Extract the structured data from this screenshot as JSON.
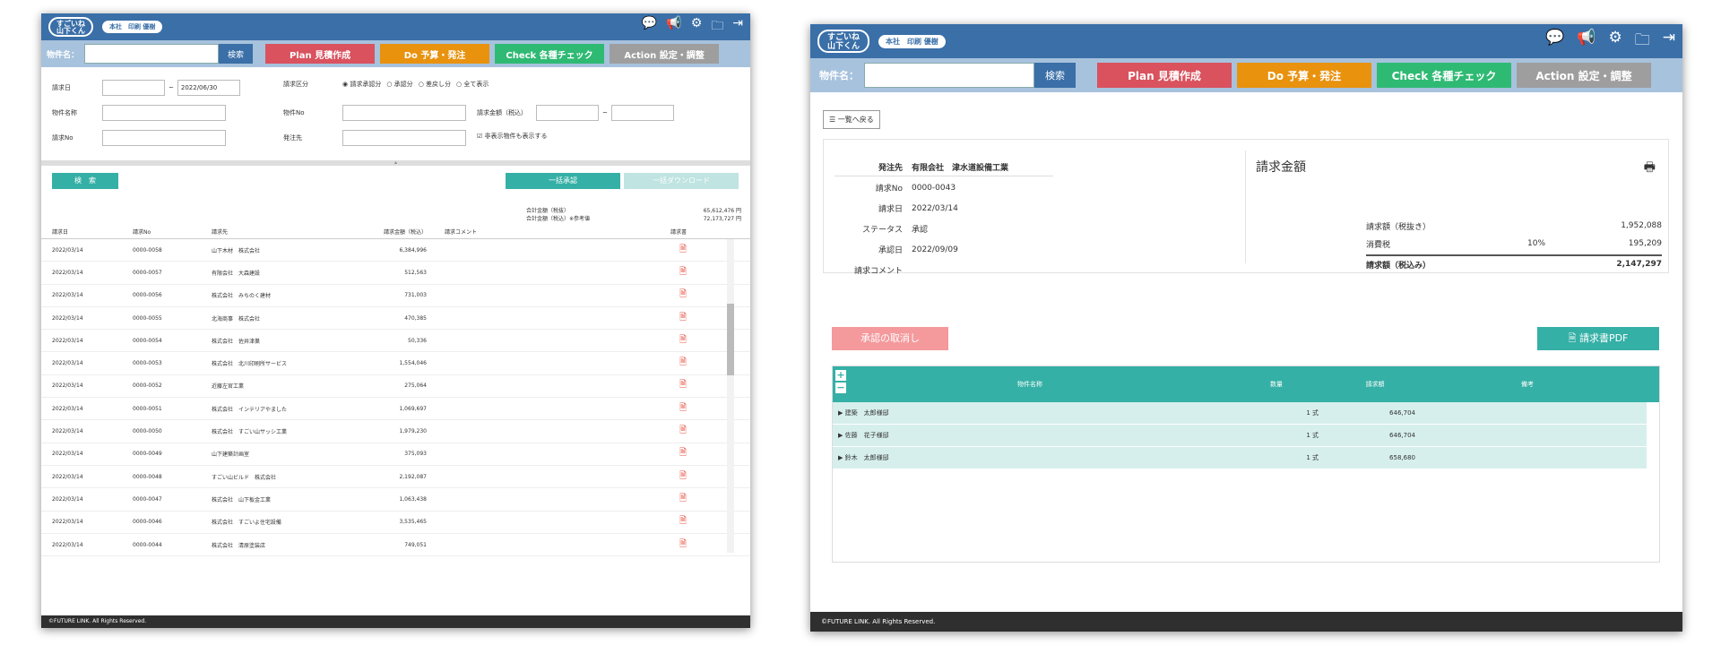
{
  "app": {
    "logo_text": "すごいね\n山下くん",
    "user": "本社　印刷 優樹",
    "icons": [
      "chat-icon",
      "megaphone-icon",
      "gear-icon",
      "folder-icon",
      "logout-icon"
    ]
  },
  "nav": {
    "property_label": "物件名：",
    "search_label": "検索",
    "plan": "Plan 見積作成",
    "do": "Do 予算・発注",
    "check": "Check 各種チェック",
    "action": "Action 設定・調整"
  },
  "list": {
    "filters": {
      "date_label": "請求日",
      "date_from": "",
      "date_sep": "~",
      "date_to": "2022/06/30",
      "type_label": "請求区分",
      "radio_1": "◉ 請求承認分",
      "radio_2": "○ 承認分",
      "radio_3": "○ 差戻し分",
      "radio_4": "○ 全て表示",
      "name_label": "物件名称",
      "propno_label": "物件No",
      "amount_label": "請求金額（税込）",
      "amount_sep": "~",
      "invno_label": "請求No",
      "dest_label": "発注先",
      "hidden_label": "☑ 非表示物件も表示する"
    },
    "buttons": {
      "search": "検　索",
      "bulk_approve": "一括承認",
      "bulk_download": "一括ダウンロード"
    },
    "totals": {
      "label_ex": "合計金額（税抜）",
      "value_ex": "65,612,476 円",
      "label_in": "合計金額（税込）※参考値",
      "value_in": "72,173,727 円"
    },
    "columns": {
      "date": "請求日",
      "no": "請求No",
      "dest": "請求先",
      "amount": "請求金額（税込）",
      "comment": "請求コメント",
      "doc": "請求書"
    },
    "rows": [
      {
        "date": "2022/03/14",
        "no": "0000-0058",
        "dest": "山下木材　株式会社",
        "amount": "6,384,996"
      },
      {
        "date": "2022/03/14",
        "no": "0000-0057",
        "dest": "有限会社　大森建設",
        "amount": "512,563"
      },
      {
        "date": "2022/03/14",
        "no": "0000-0056",
        "dest": "株式会社　みちのく建材",
        "amount": "731,003"
      },
      {
        "date": "2022/03/14",
        "no": "0000-0055",
        "dest": "北海商事　株式会社",
        "amount": "470,385"
      },
      {
        "date": "2022/03/14",
        "no": "0000-0054",
        "dest": "株式会社　佐井津巣",
        "amount": "50,336"
      },
      {
        "date": "2022/03/14",
        "no": "0000-0053",
        "dest": "株式会社　北川印刷所サービス",
        "amount": "1,554,046"
      },
      {
        "date": "2022/03/14",
        "no": "0000-0052",
        "dest": "近藤左官工業",
        "amount": "275,064"
      },
      {
        "date": "2022/03/14",
        "no": "0000-0051",
        "dest": "株式会社　インテリアやました",
        "amount": "1,069,697"
      },
      {
        "date": "2022/03/14",
        "no": "0000-0050",
        "dest": "株式会社　すごい山サッシ工業",
        "amount": "1,979,230"
      },
      {
        "date": "2022/03/14",
        "no": "0000-0049",
        "dest": "山下建築計画室",
        "amount": "375,093"
      },
      {
        "date": "2022/03/14",
        "no": "0000-0048",
        "dest": "すごい山ビルド　株式会社",
        "amount": "2,192,087"
      },
      {
        "date": "2022/03/14",
        "no": "0000-0047",
        "dest": "株式会社　山下板金工業",
        "amount": "1,063,438"
      },
      {
        "date": "2022/03/14",
        "no": "0000-0046",
        "dest": "株式会社　すごいよ住宅設備",
        "amount": "3,535,465"
      },
      {
        "date": "2022/03/14",
        "no": "0000-0044",
        "dest": "株式会社　清原塗装店",
        "amount": "749,051"
      }
    ]
  },
  "detail": {
    "back": "☰ 一覧へ戻る",
    "fields": {
      "dest_k": "発注先",
      "dest_v": "有限会社　津水道設備工業",
      "no_k": "請求No",
      "no_v": "0000-0043",
      "date_k": "請求日",
      "date_v": "2022/03/14",
      "status_k": "ステータス",
      "status_v": "承認",
      "approved_k": "承認日",
      "approved_v": "2022/09/09",
      "comment_k": "請求コメント",
      "comment_v": ""
    },
    "amount_title": "請求金額",
    "summary": {
      "ex_label": "請求額（税抜き）",
      "ex_value": "1,952,088",
      "tax_label": "消費税",
      "tax_rate": "10%",
      "tax_value": "195,209",
      "in_label": "請求額（税込み）",
      "in_value": "2,147,297"
    },
    "cancel": "承認の取消し",
    "pdf": "🗎 請求書PDF",
    "grid": {
      "plus": "+",
      "minus": "−",
      "h_name": "物件名称",
      "h_qty": "数量",
      "h_amt": "請求額",
      "h_note": "備考",
      "rows": [
        {
          "name": "▶ 建築　太郎様邸",
          "qty": "1 式",
          "amt": "646,704"
        },
        {
          "name": "▶ 佐藤　花子様邸",
          "qty": "1 式",
          "amt": "646,704"
        },
        {
          "name": "▶ 鈴木　太郎様邸",
          "qty": "1 式",
          "amt": "658,680"
        }
      ]
    }
  },
  "footer": "©FUTURE LINK. All Rights Reserved."
}
